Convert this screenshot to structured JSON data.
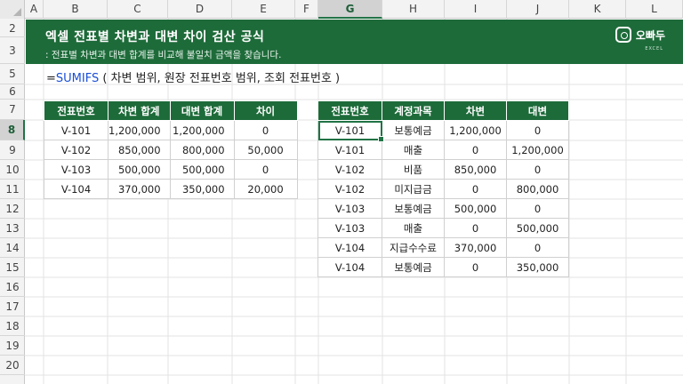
{
  "sheet": {
    "columns": [
      "A",
      "B",
      "C",
      "D",
      "E",
      "F",
      "G",
      "H",
      "I",
      "J",
      "K",
      "L"
    ],
    "selected_column": "G",
    "rows": [
      "2",
      "3",
      "5",
      "6",
      "7",
      "8",
      "9",
      "10",
      "11",
      "12",
      "13",
      "14",
      "15",
      "16",
      "17",
      "18",
      "19",
      "20"
    ],
    "selected_row": "8"
  },
  "banner": {
    "title": "엑셀 전표별 차변과 대변 차이 검산 공식",
    "subtitle": ": 전표별 차변과 대변 합계를 비교해 불일치 금액을 찾습니다.",
    "logo_text": "오빠두",
    "logo_sub": "EXCEL",
    "background": "#1e6b3a"
  },
  "formula": {
    "prefix": "=",
    "function": "SUMIFS",
    "args": " ( 차변 범위, 원장 전표번호 범위, 조회 전표번호 )"
  },
  "summary_table": {
    "headers": [
      "전표번호",
      "차변 합계",
      "대변 합계",
      "차이"
    ],
    "rows": [
      [
        "V-101",
        "1,200,000",
        "1,200,000",
        "0"
      ],
      [
        "V-102",
        "850,000",
        "800,000",
        "50,000"
      ],
      [
        "V-103",
        "500,000",
        "500,000",
        "0"
      ],
      [
        "V-104",
        "370,000",
        "350,000",
        "20,000"
      ]
    ]
  },
  "ledger_table": {
    "headers": [
      "전표번호",
      "계정과목",
      "차변",
      "대변"
    ],
    "rows": [
      [
        "V-101",
        "보통예금",
        "1,200,000",
        "0"
      ],
      [
        "V-101",
        "매출",
        "0",
        "1,200,000"
      ],
      [
        "V-102",
        "비품",
        "850,000",
        "0"
      ],
      [
        "V-102",
        "미지급금",
        "0",
        "800,000"
      ],
      [
        "V-103",
        "보통예금",
        "500,000",
        "0"
      ],
      [
        "V-103",
        "매출",
        "0",
        "500,000"
      ],
      [
        "V-104",
        "지급수수료",
        "370,000",
        "0"
      ],
      [
        "V-104",
        "보통예금",
        "0",
        "350,000"
      ]
    ]
  }
}
